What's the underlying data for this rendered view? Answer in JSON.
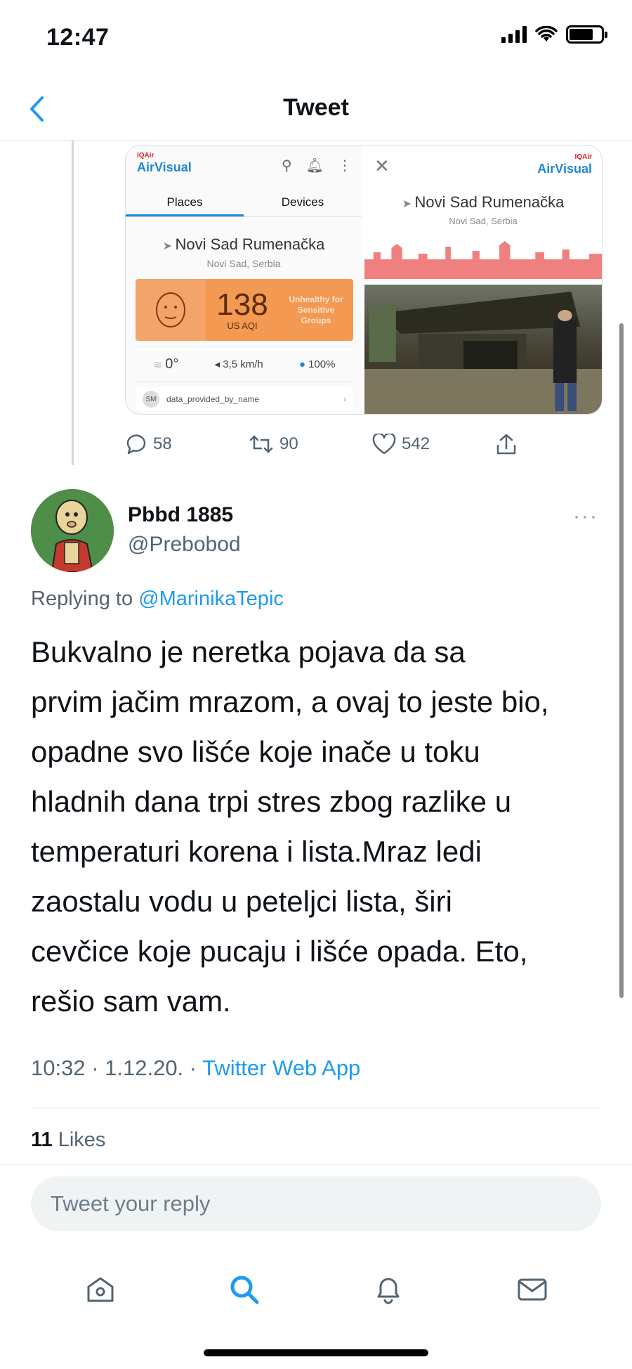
{
  "status_bar": {
    "time": "12:47"
  },
  "nav": {
    "title": "Tweet"
  },
  "embedded_media": {
    "left_screen": {
      "brand_small": "IQAir",
      "brand": "AirVisual",
      "tabs": [
        "Places",
        "Devices"
      ],
      "location": "Novi Sad Rumenačka",
      "location_sub": "Novi Sad, Serbia",
      "aqi_value": "138",
      "aqi_unit": "US AQI",
      "aqi_status": "Unhealthy for Sensitive Groups",
      "temperature": "0°",
      "wind": "3,5 km/h",
      "humidity": "100%",
      "provider_badge": "SM",
      "provider_text": "data_provided_by_name"
    },
    "right_screen": {
      "brand_small": "IQAir",
      "brand": "AirVisual",
      "location": "Novi Sad Rumenačka",
      "location_sub": "Novi Sad, Serbia"
    }
  },
  "parent_actions": {
    "replies": "58",
    "retweets": "90",
    "likes": "542"
  },
  "tweet": {
    "display_name": "Pbbd 1885",
    "handle": "@Prebobod",
    "replying_prefix": "Replying to ",
    "replying_to": "@MarinikaTepic",
    "text": "Bukvalno je neretka pojava da sa\nprvim jačim mrazom, a ovaj to jeste bio,\nopadne svo lišće koje inače u toku\nhladnih dana trpi stres zbog razlike u\ntemperaturi korena i lista.Mraz  ledi\nzaostalu vodu u peteljci lista, širi\ncevčice koje pucaju i lišće opada. Eto,\nrešio sam vam.",
    "time_date": "10:32 · 1.12.20. · ",
    "source": "Twitter Web App",
    "likes_count": "11",
    "likes_label": " Likes"
  },
  "reply": {
    "placeholder": "Tweet your reply"
  },
  "tab_bar": [
    "home-icon",
    "search-icon",
    "notifications-icon",
    "messages-icon"
  ],
  "colors": {
    "accent": "#1d9bf0",
    "aqi_orange": "#f49952"
  }
}
